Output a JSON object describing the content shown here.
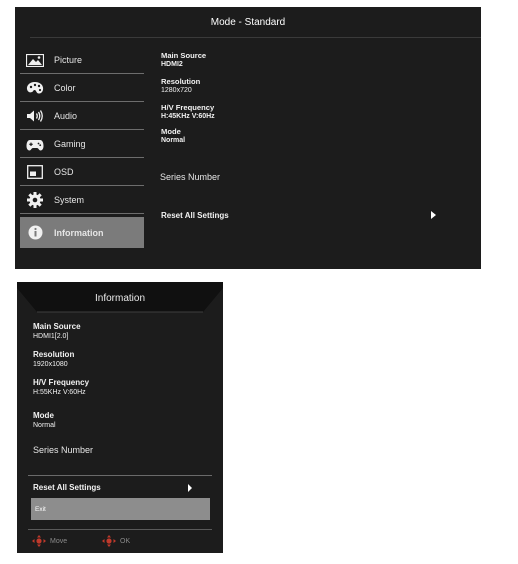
{
  "panel1": {
    "title": "Mode - Standard",
    "menu": [
      {
        "label": "Picture",
        "icon": "picture-icon"
      },
      {
        "label": "Color",
        "icon": "palette-icon"
      },
      {
        "label": "Audio",
        "icon": "speaker-icon"
      },
      {
        "label": "Gaming",
        "icon": "gamepad-icon"
      },
      {
        "label": "OSD",
        "icon": "osd-icon"
      },
      {
        "label": "System",
        "icon": "gear-icon"
      },
      {
        "label": "Information",
        "icon": "info-icon",
        "selected": true
      }
    ],
    "info": {
      "main_source_label": "Main Source",
      "main_source_value": "HDMI2",
      "resolution_label": "Resolution",
      "resolution_value": "1280x720",
      "hv_label": "H/V Frequency",
      "hv_value": "H:45KHz V:60Hz",
      "mode_label": "Mode",
      "mode_value": "Normal",
      "series_label": "Series Number",
      "reset_label": "Reset All Settings"
    }
  },
  "panel2": {
    "title": "Information",
    "info": {
      "main_source_label": "Main Source",
      "main_source_value": "HDMI1[2.0]",
      "resolution_label": "Resolution",
      "resolution_value": "1920x1080",
      "hv_label": "H/V Frequency",
      "hv_value": "H:55KHz V:60Hz",
      "mode_label": "Mode",
      "mode_value": "Normal",
      "series_label": "Series Number",
      "reset_label": "Reset All Settings",
      "exit_label": "Exit"
    },
    "footer": {
      "move_label": "Move",
      "ok_label": "OK"
    }
  },
  "colors": {
    "osd_bg": "#1c1c1c",
    "selected_bg": "#7b7b7b",
    "exit_bg": "#8d8d8d",
    "footer_icon": "#c0392b"
  }
}
